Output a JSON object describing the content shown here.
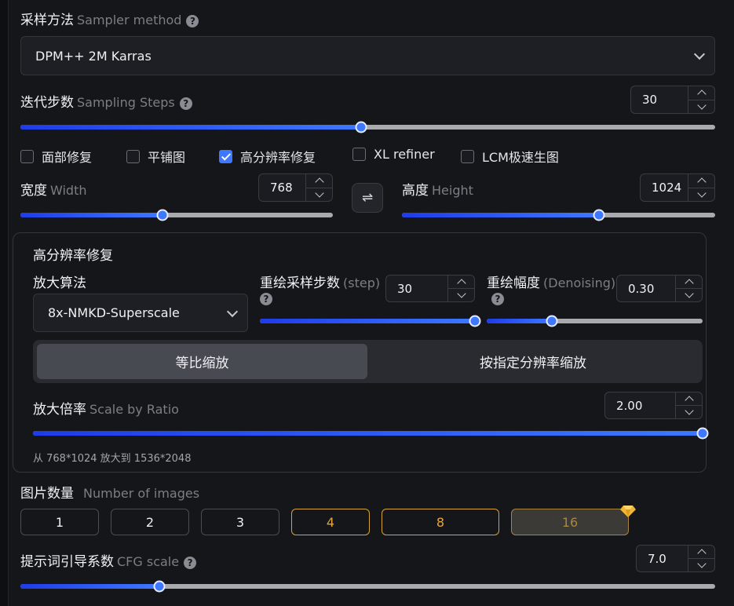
{
  "sampler": {
    "label_cn": "采样方法",
    "label_en": "Sampler method",
    "help": "?",
    "value": "DPM++ 2M Karras"
  },
  "steps": {
    "label_cn": "迭代步数",
    "label_en": "Sampling Steps",
    "help": "?",
    "value": "30",
    "slider_fraction": 0.49
  },
  "options": [
    {
      "label": "面部修复",
      "checked": false
    },
    {
      "label": "平铺图",
      "checked": false
    },
    {
      "label": "高分辨率修复",
      "checked": true
    },
    {
      "label": "XL refiner",
      "checked": false
    },
    {
      "label": "LCM极速生图",
      "checked": false
    }
  ],
  "width": {
    "label_cn": "宽度",
    "label_en": "Width",
    "value": "768",
    "slider_fraction": 0.455
  },
  "swap_icon": "⇌",
  "height": {
    "label_cn": "高度",
    "label_en": "Height",
    "value": "1024",
    "slider_fraction": 0.63
  },
  "hires": {
    "title": "高分辨率修复",
    "upscaler": {
      "label": "放大算法",
      "value": "8x-NMKD-Superscale"
    },
    "hires_steps": {
      "label_cn": "重绘采样步数",
      "label_en": "(step)",
      "help": "?",
      "value": "30",
      "slider_fraction": 1.0
    },
    "denoising": {
      "label_cn": "重绘幅度",
      "label_en": "(Denoising)",
      "help": "?",
      "value": "0.30",
      "slider_fraction": 0.3
    },
    "mode_tabs": [
      "等比缩放",
      "按指定分辨率缩放"
    ],
    "active_tab": 0,
    "scale": {
      "label_cn": "放大倍率",
      "label_en": "Scale by Ratio",
      "value": "2.00",
      "slider_fraction": 1.0
    },
    "summary": "从 768*1024 放大到 1536*2048"
  },
  "batch": {
    "label_cn": "图片数量",
    "label_en": "Number of images",
    "options": [
      "1",
      "2",
      "3",
      "4",
      "8",
      "16"
    ],
    "selected": "16"
  },
  "cfg": {
    "label_cn": "提示词引导系数",
    "label_en": "CFG scale",
    "help": "?",
    "value": "7.0",
    "slider_fraction": 0.2
  },
  "colors": {
    "accent": "#3d78ff",
    "vip_gold": "#e8a53b"
  }
}
